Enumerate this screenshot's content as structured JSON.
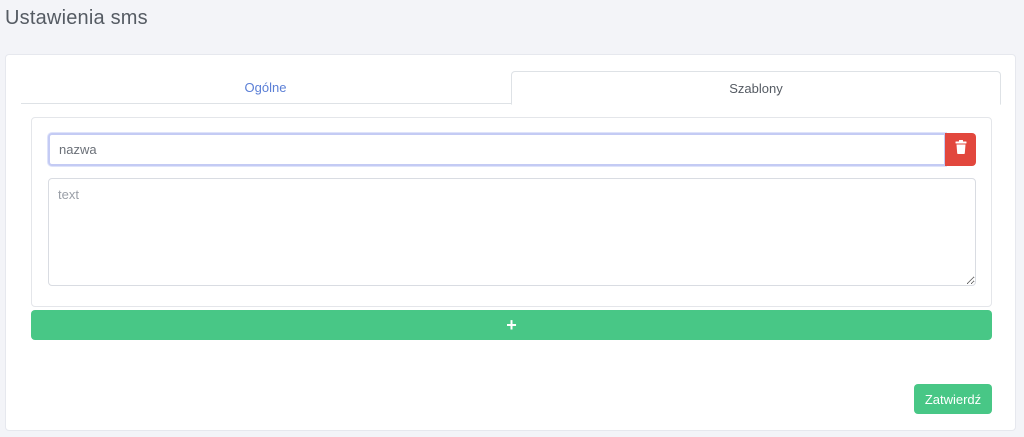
{
  "page": {
    "title": "Ustawienia sms"
  },
  "tabs": [
    {
      "label": "Ogólne",
      "active": false
    },
    {
      "label": "Szablony",
      "active": true
    }
  ],
  "template": {
    "name_placeholder": "nazwa",
    "name_value": "",
    "text_placeholder": "text",
    "text_value": "",
    "delete_icon": "trash-icon"
  },
  "actions": {
    "add_label": "+",
    "submit_label": "Zatwierdź"
  },
  "colors": {
    "accent_green": "#48c786",
    "danger_red": "#e2473d",
    "tab_link": "#5b7fd6"
  }
}
